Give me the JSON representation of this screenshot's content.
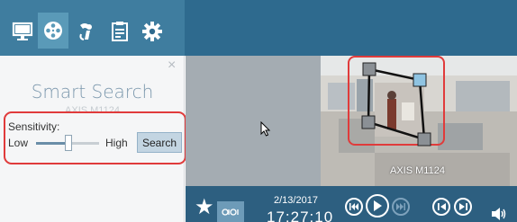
{
  "toolbar": {
    "icons": [
      "monitor-icon",
      "film-reel-icon",
      "recordings-icon",
      "clipboard-icon",
      "gear-icon"
    ],
    "active_index": 1
  },
  "panel": {
    "close_glyph": "×",
    "title": "Smart Search",
    "camera_name": "AXIS M1124",
    "sensitivity_label": "Sensitivity:",
    "low_label": "Low",
    "high_label": "High",
    "search_label": "Search",
    "sensitivity_fraction": 0.52
  },
  "video": {
    "camera_label": "AXIS M1124"
  },
  "playback": {
    "star_glyph": "★",
    "date": "2/13/2017",
    "time": "17:27:10"
  },
  "colors": {
    "toolbar": "#2e6a8e",
    "panel_bg": "#f5f6f7",
    "highlight": "#e03b3b",
    "bottom_bar": "#2d5f80"
  }
}
